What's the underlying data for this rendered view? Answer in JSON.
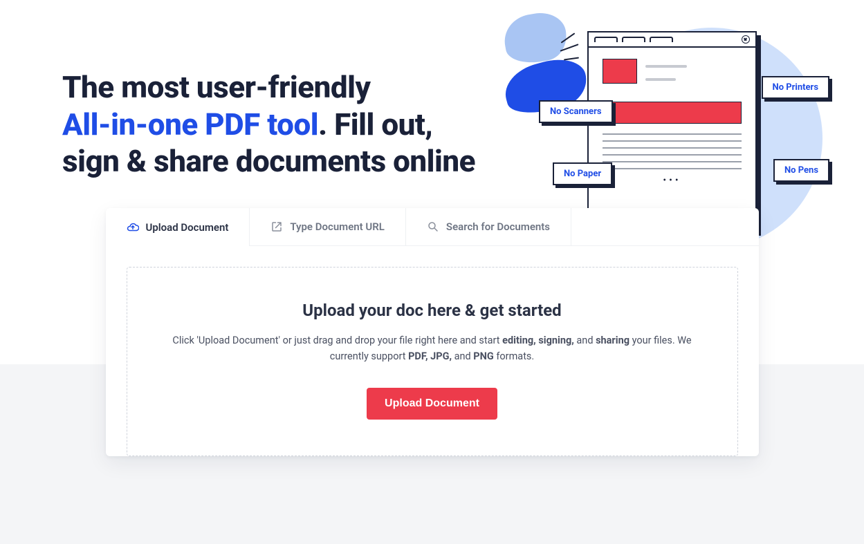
{
  "hero": {
    "line1": "The most user-friendly",
    "accent": "All-in-one PDF tool",
    "line2_rest": ". Fill out,",
    "line3": "sign & share documents online"
  },
  "illustration_tags": {
    "scanners": "No Scanners",
    "printers": "No Printers",
    "paper": "No Paper",
    "pens": "No Pens"
  },
  "tabs": {
    "upload": "Upload Document",
    "url": "Type Document URL",
    "search": "Search for Documents"
  },
  "dropzone": {
    "title": "Upload your doc here & get started",
    "desc_pre": "Click 'Upload Document' or just drag and drop your file right here and start ",
    "b1": "editing,",
    "sep1": " ",
    "b2": "signing,",
    "sep2": " and ",
    "b3": "sharing",
    "desc_mid": " your files. We currently support ",
    "b4": "PDF, JPG,",
    "sep3": " and ",
    "b5": "PNG",
    "desc_post": " formats.",
    "button": "Upload Document"
  },
  "colors": {
    "accent": "#1f4de6",
    "danger": "#ed3b4b",
    "text": "#1a2138"
  }
}
